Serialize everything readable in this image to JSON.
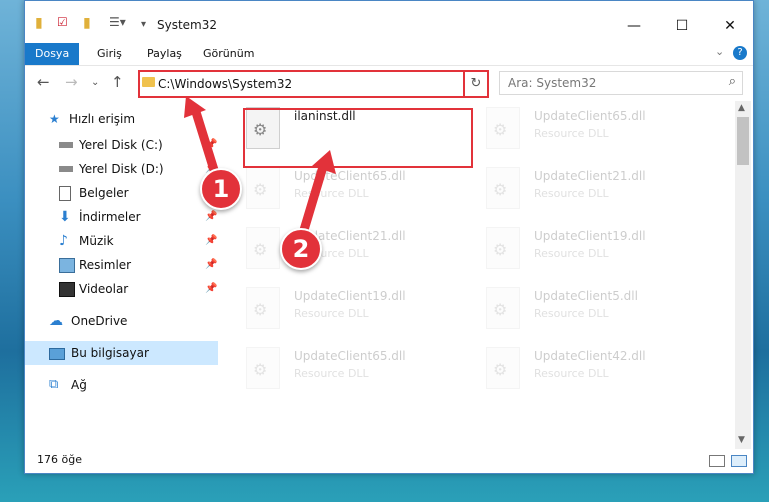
{
  "window": {
    "title": "System32"
  },
  "ribbon": {
    "tabs": [
      "Dosya",
      "Giriş",
      "Paylaş",
      "Görünüm"
    ]
  },
  "address": {
    "path": "C:\\Windows\\System32",
    "search_placeholder": "Ara: System32"
  },
  "sidebar": {
    "items": [
      {
        "label": "Hızlı erişim",
        "icon": "star-icon",
        "pinned": false
      },
      {
        "label": "Yerel Disk (C:)",
        "icon": "drive-icon",
        "pinned": true
      },
      {
        "label": "Yerel Disk (D:)",
        "icon": "drive-icon",
        "pinned": true
      },
      {
        "label": "Belgeler",
        "icon": "documents-icon",
        "pinned": true
      },
      {
        "label": "İndirmeler",
        "icon": "download-icon",
        "pinned": true
      },
      {
        "label": "Müzik",
        "icon": "music-icon",
        "pinned": true
      },
      {
        "label": "Resimler",
        "icon": "pictures-icon",
        "pinned": true
      },
      {
        "label": "Videolar",
        "icon": "video-icon",
        "pinned": true
      },
      {
        "label": "OneDrive",
        "icon": "cloud-icon",
        "pinned": false
      },
      {
        "label": "Bu bilgisayar",
        "icon": "computer-icon",
        "pinned": false,
        "selected": true
      },
      {
        "label": "Ağ",
        "icon": "network-icon",
        "pinned": false
      }
    ]
  },
  "files": [
    {
      "name": "ilaninst.dll",
      "desc": "",
      "highlight": true
    },
    {
      "name": "UpdateClient65.dll",
      "desc": "Resource DLL"
    },
    {
      "name": "UpdateClient65.dll",
      "desc": "Resource DLL"
    },
    {
      "name": "UpdateClient21.dll",
      "desc": "Resource DLL"
    },
    {
      "name": "UpdateClient21.dll",
      "desc": "Resource DLL"
    },
    {
      "name": "UpdateClient19.dll",
      "desc": "Resource DLL"
    },
    {
      "name": "UpdateClient19.dll",
      "desc": "Resource DLL"
    },
    {
      "name": "UpdateClient5.dll",
      "desc": "Resource DLL"
    },
    {
      "name": "UpdateClient65.dll",
      "desc": "Resource DLL"
    },
    {
      "name": "UpdateClient42.dll",
      "desc": "Resource DLL"
    }
  ],
  "status": {
    "count": "176 öğe"
  },
  "annotations": {
    "step1": "1",
    "step2": "2"
  },
  "colors": {
    "accent": "#1979ca",
    "highlight": "#e2323a",
    "selected": "#cce8ff"
  }
}
